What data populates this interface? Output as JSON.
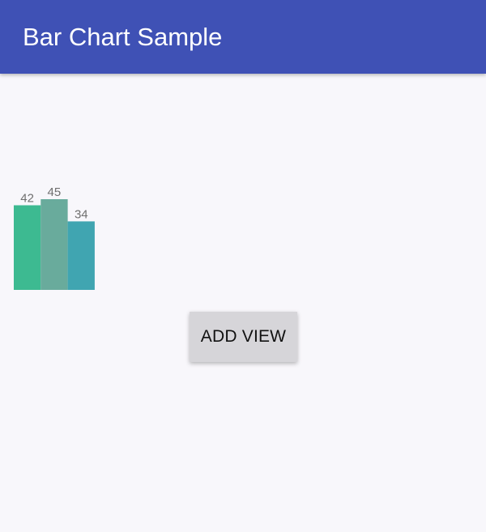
{
  "app_bar": {
    "title": "Bar Chart Sample",
    "color": "#3f51b5"
  },
  "chart_data": {
    "type": "bar",
    "categories": [
      "",
      "",
      ""
    ],
    "values": [
      42,
      45,
      34
    ],
    "data_labels": [
      "42",
      "45",
      "34"
    ],
    "colors": [
      "#3dba91",
      "#69ab9c",
      "#40a5b1"
    ],
    "title": "",
    "xlabel": "",
    "ylabel": "",
    "ylim": [
      0,
      45
    ],
    "grid": false,
    "legend": "none"
  },
  "actions": {
    "add_view_label": "ADD VIEW"
  }
}
